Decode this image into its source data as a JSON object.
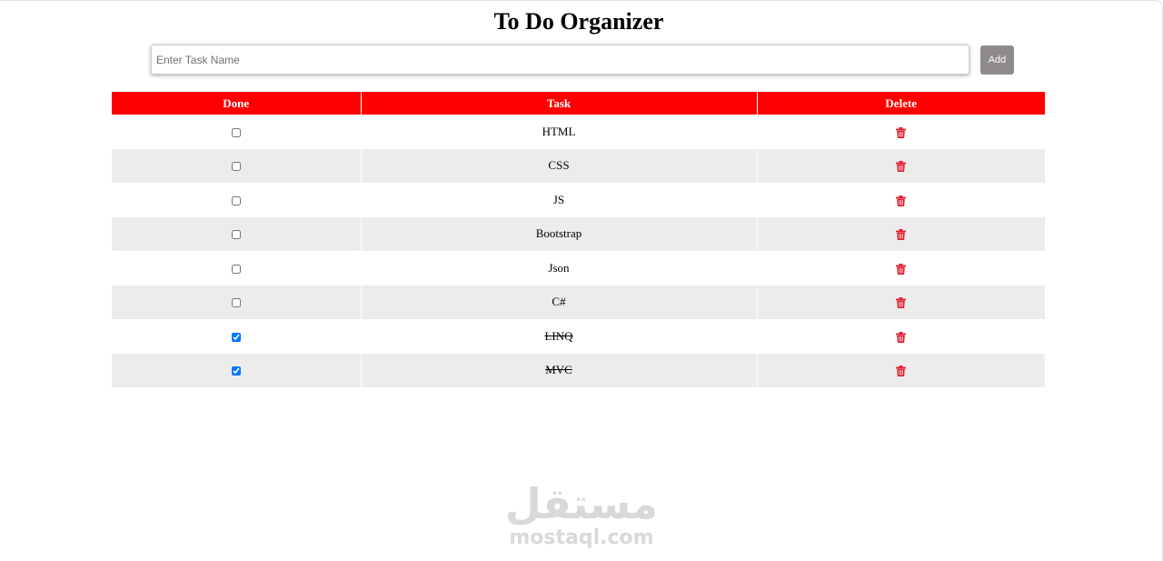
{
  "header": {
    "title": "To Do Organizer"
  },
  "form": {
    "input_placeholder": "Enter Task Name",
    "input_value": "",
    "add_label": "Add"
  },
  "table": {
    "columns": [
      "Done",
      "Task",
      "Delete"
    ],
    "rows": [
      {
        "task": "HTML",
        "done": false
      },
      {
        "task": "CSS",
        "done": false
      },
      {
        "task": "JS",
        "done": false
      },
      {
        "task": "Bootstrap",
        "done": false
      },
      {
        "task": "Json",
        "done": false
      },
      {
        "task": "C#",
        "done": false
      },
      {
        "task": "LINQ",
        "done": true
      },
      {
        "task": "MVC",
        "done": true
      }
    ],
    "delete_icon": "trash-icon"
  },
  "colors": {
    "header_bg": "#ff0000",
    "stripe_bg": "#ececec",
    "add_button_bg": "#8f8a8a",
    "delete_icon": "#e01e2d"
  },
  "watermark": {
    "arabic": "مستقل",
    "latin": "mostaql.com"
  }
}
